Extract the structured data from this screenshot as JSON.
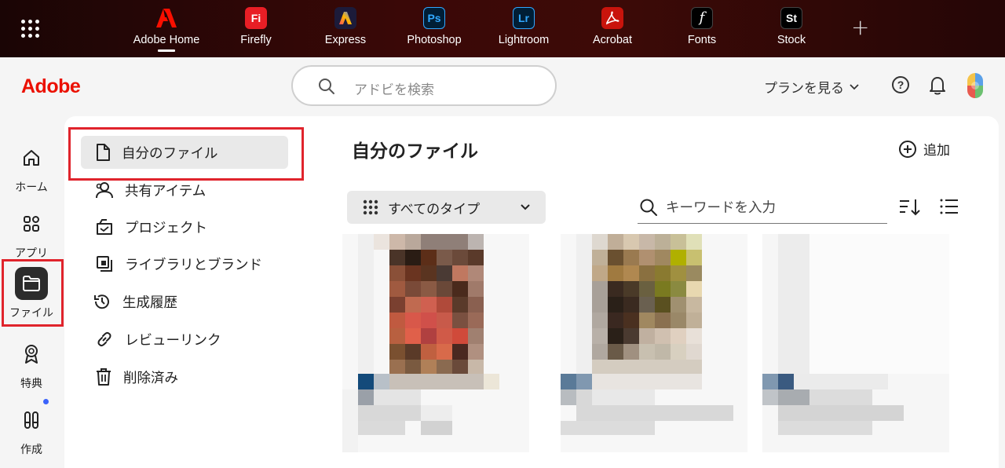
{
  "appbar": {
    "apps": [
      {
        "label": "Adobe Home",
        "glyph": "A",
        "color": "#fa0f00",
        "bg": "transparent",
        "active": true
      },
      {
        "label": "Firefly",
        "glyph": "Fi",
        "color": "#ffffff",
        "bg": "#e81e25",
        "active": false
      },
      {
        "label": "Express",
        "glyph": "A",
        "color": "#ffffff",
        "bg": "#1c1b3a",
        "active": false
      },
      {
        "label": "Photoshop",
        "glyph": "Ps",
        "color": "#31a8ff",
        "bg": "#001e36",
        "active": false
      },
      {
        "label": "Lightroom",
        "glyph": "Lr",
        "color": "#31a8ff",
        "bg": "#001e36",
        "active": false
      },
      {
        "label": "Acrobat",
        "glyph": "A",
        "color": "#ffffff",
        "bg": "#c9140c",
        "active": false
      },
      {
        "label": "Fonts",
        "glyph": "f",
        "color": "#ffffff",
        "bg": "#000000",
        "active": false
      },
      {
        "label": "Stock",
        "glyph": "St",
        "color": "#ffffff",
        "bg": "#000000",
        "active": false
      }
    ],
    "add_glyph": "+"
  },
  "header": {
    "logo": "Adobe",
    "search_placeholder": "アドビを検索",
    "plan_label": "プランを見る",
    "help_glyph": "?"
  },
  "rail": {
    "items": [
      {
        "label": "ホーム",
        "icon": "home-icon"
      },
      {
        "label": "アプリ",
        "icon": "apps-icon"
      },
      {
        "label": "ファイル",
        "icon": "folder-icon",
        "active": true
      },
      {
        "label": "特典",
        "icon": "badge-icon"
      },
      {
        "label": "作成",
        "icon": "create-icon",
        "notification": true
      }
    ]
  },
  "subnav": {
    "items": [
      {
        "label": "自分のファイル",
        "icon": "file-icon",
        "active": true
      },
      {
        "label": "共有アイテム",
        "icon": "shared-icon"
      },
      {
        "label": "プロジェクト",
        "icon": "project-icon"
      },
      {
        "label": "ライブラリとブランド",
        "icon": "library-icon"
      },
      {
        "label": "生成履歴",
        "icon": "history-icon"
      },
      {
        "label": "レビューリンク",
        "icon": "link-icon"
      },
      {
        "label": "削除済み",
        "icon": "trash-icon"
      }
    ]
  },
  "main": {
    "title": "自分のファイル",
    "add_label": "追加",
    "type_filter": "すべてのタイプ",
    "keyword_placeholder": "キーワードを入力"
  },
  "colors": {
    "accent": "#eb1000",
    "highlight_border": "#e0242c",
    "notification_dot": "#3b63fb"
  }
}
